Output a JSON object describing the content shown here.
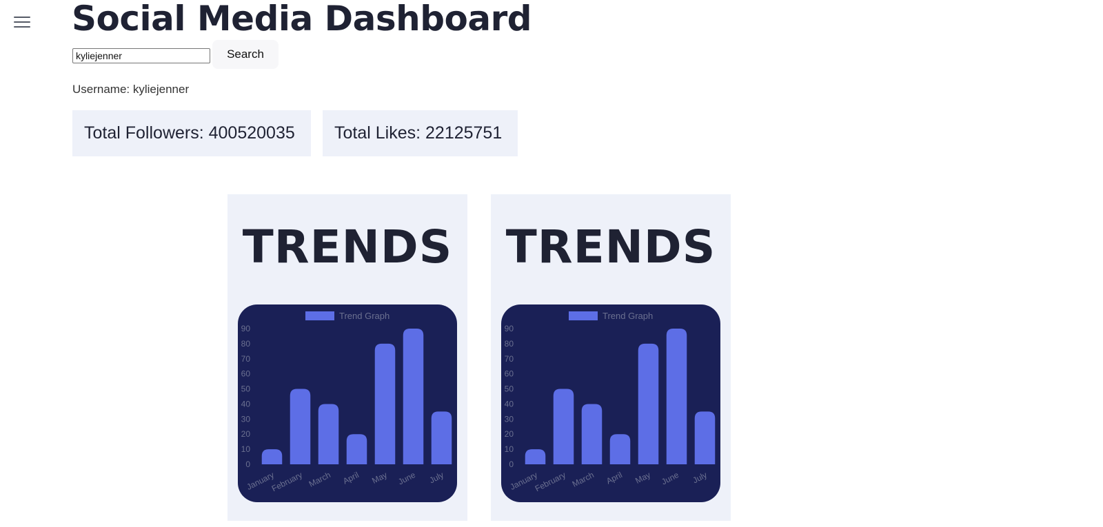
{
  "header": {
    "title": "Social Media Dashboard",
    "menu_icon": "hamburger-menu-icon"
  },
  "search": {
    "value": "kyliejenner",
    "button_label": "Search"
  },
  "profile": {
    "username_text": "Username: kyliejenner"
  },
  "stats": {
    "followers_text": "Total Followers: 400520035",
    "likes_text": "Total Likes: 22125751"
  },
  "cards": [
    {
      "title": "TRENDS"
    },
    {
      "title": "TRENDS"
    }
  ],
  "colors": {
    "accent": "#5d6ee6",
    "chart_bg": "#1a2056",
    "card_bg": "#eef1f9",
    "axis_text": "#6b7090"
  },
  "chart_data": [
    {
      "type": "bar",
      "categories": [
        "January",
        "February",
        "March",
        "April",
        "May",
        "June",
        "July"
      ],
      "series": [
        {
          "name": "Trend Graph",
          "values": [
            10,
            50,
            40,
            20,
            80,
            90,
            35
          ]
        }
      ],
      "ylim": [
        0,
        90
      ],
      "yticks": [
        0,
        10,
        20,
        30,
        40,
        50,
        60,
        70,
        80,
        90
      ],
      "grid": false,
      "legend": "top-center"
    },
    {
      "type": "bar",
      "categories": [
        "January",
        "February",
        "March",
        "April",
        "May",
        "June",
        "July"
      ],
      "series": [
        {
          "name": "Trend Graph",
          "values": [
            10,
            50,
            40,
            20,
            80,
            90,
            35
          ]
        }
      ],
      "ylim": [
        0,
        90
      ],
      "yticks": [
        0,
        10,
        20,
        30,
        40,
        50,
        60,
        70,
        80,
        90
      ],
      "grid": false,
      "legend": "top-center"
    }
  ]
}
